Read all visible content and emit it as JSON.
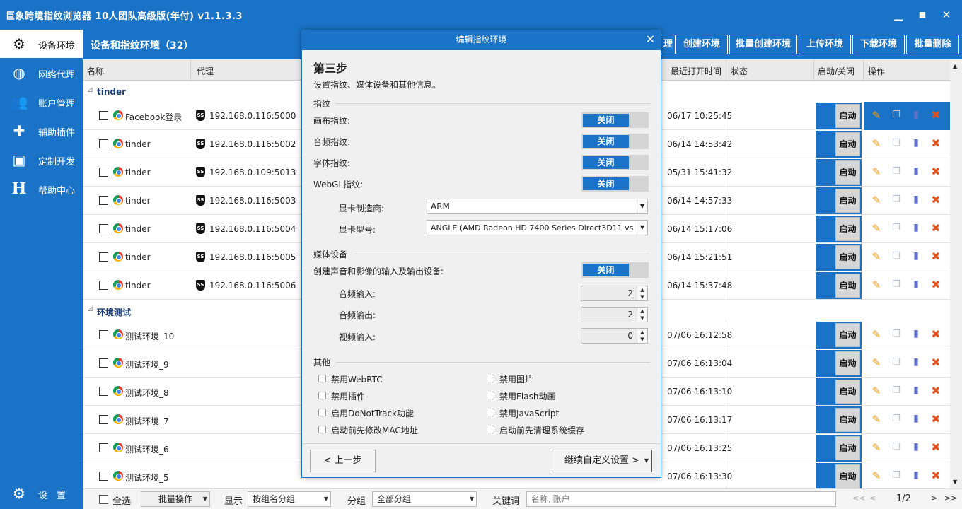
{
  "app": {
    "title": "巨象跨境指纹浏览器 10人团队高级版(年付) v1.1.3.3",
    "minimize": "▁",
    "maximize": "■",
    "close": "✕"
  },
  "sidebar": {
    "items": [
      {
        "label": "设备环境",
        "icon": "gear-icon",
        "active": true
      },
      {
        "label": "网络代理",
        "icon": "globe-icon"
      },
      {
        "label": "账户管理",
        "icon": "users-icon"
      },
      {
        "label": "辅助插件",
        "icon": "puzzle-icon"
      },
      {
        "label": "定制开发",
        "icon": "id-card-icon"
      },
      {
        "label": "帮助中心",
        "icon": "help-h-icon"
      }
    ],
    "settings": "设　置"
  },
  "header": {
    "title": "设备和指纹环境（32）",
    "partial_button": "理",
    "buttons": [
      "创建环境",
      "批量创建环境",
      "上传环境",
      "下载环境",
      "批量删除"
    ]
  },
  "columns": {
    "name": "名称",
    "proxy": "代理",
    "last_open": "最近打开时间",
    "status": "状态",
    "onoff": "启动/关闭",
    "ops": "操作"
  },
  "groups": [
    {
      "label": "tinder"
    },
    {
      "label": "环境测试"
    }
  ],
  "rows": [
    {
      "name": "Facebook登录",
      "proxy": "192.168.0.116:5000",
      "last": "06/17 10:25:45",
      "btn": "启动"
    },
    {
      "name": "tinder",
      "proxy": "192.168.0.116:5002",
      "last": "06/14 14:53:42",
      "btn": "启动"
    },
    {
      "name": "tinder",
      "proxy": "192.168.0.109:5013",
      "last": "05/31 15:41:32",
      "btn": "启动"
    },
    {
      "name": "tinder",
      "proxy": "192.168.0.116:5003",
      "last": "06/14 14:57:33",
      "btn": "启动"
    },
    {
      "name": "tinder",
      "proxy": "192.168.0.116:5004",
      "last": "06/14 15:17:06",
      "btn": "启动"
    },
    {
      "name": "tinder",
      "proxy": "192.168.0.116:5005",
      "last": "06/14 15:21:51",
      "btn": "启动"
    },
    {
      "name": "tinder",
      "proxy": "192.168.0.116:5006",
      "last": "06/14 15:37:48",
      "btn": "启动"
    },
    {
      "name": "测试环境_10",
      "proxy": "",
      "last": "07/06 16:12:58",
      "btn": "启动"
    },
    {
      "name": "测试环境_9",
      "proxy": "",
      "last": "07/06 16:13:04",
      "btn": "启动"
    },
    {
      "name": "测试环境_8",
      "proxy": "",
      "last": "07/06 16:13:10",
      "btn": "启动"
    },
    {
      "name": "测试环境_7",
      "proxy": "",
      "last": "07/06 16:13:17",
      "btn": "启动"
    },
    {
      "name": "测试环境_6",
      "proxy": "",
      "last": "07/06 16:13:25",
      "btn": "启动"
    },
    {
      "name": "测试环境_5",
      "proxy": "",
      "last": "07/06 16:13:30",
      "btn": "启动"
    }
  ],
  "ssr_badge": "SS",
  "footer": {
    "select_all": "全选",
    "batch": "批量操作",
    "display_label": "显示",
    "display_value": "按组名分组",
    "group_label": "分组",
    "group_value": "全部分组",
    "keyword_label": "关键词",
    "keyword_placeholder": "名称, 账户",
    "page": "1/2",
    "first": "<<",
    "prev": "<",
    "next": ">",
    "last": ">>"
  },
  "dialog": {
    "title": "编辑指纹环境",
    "close": "✕",
    "step": "第三步",
    "desc": "设置指纹、媒体设备和其他信息。",
    "fingerprint": {
      "heading": "指纹",
      "canvas": "画布指纹:",
      "audio": "音频指纹:",
      "font": "字体指纹:",
      "webgl": "WebGL指纹:",
      "toggle": "关闭",
      "gpu_vendor_label": "显卡制造商:",
      "gpu_vendor": "ARM",
      "gpu_model_label": "显卡型号:",
      "gpu_model": "ANGLE (AMD Radeon HD 7400 Series Direct3D11 vs"
    },
    "media": {
      "heading": "媒体设备",
      "create": "创建声音和影像的输入及输出设备:",
      "toggle": "关闭",
      "audio_in_label": "音频输入:",
      "audio_in": "2",
      "audio_out_label": "音频输出:",
      "audio_out": "2",
      "video_in_label": "视频输入:",
      "video_in": "0"
    },
    "other": {
      "heading": "其他",
      "options": [
        "禁用WebRTC",
        "禁用插件",
        "启用DoNotTrack功能",
        "启动前先修改MAC地址",
        "禁用图片",
        "禁用Flash动画",
        "禁用JavaScript",
        "启动前先清理系统缓存"
      ]
    },
    "prev": "< 上一步",
    "next": "继续自定义设置 >"
  }
}
